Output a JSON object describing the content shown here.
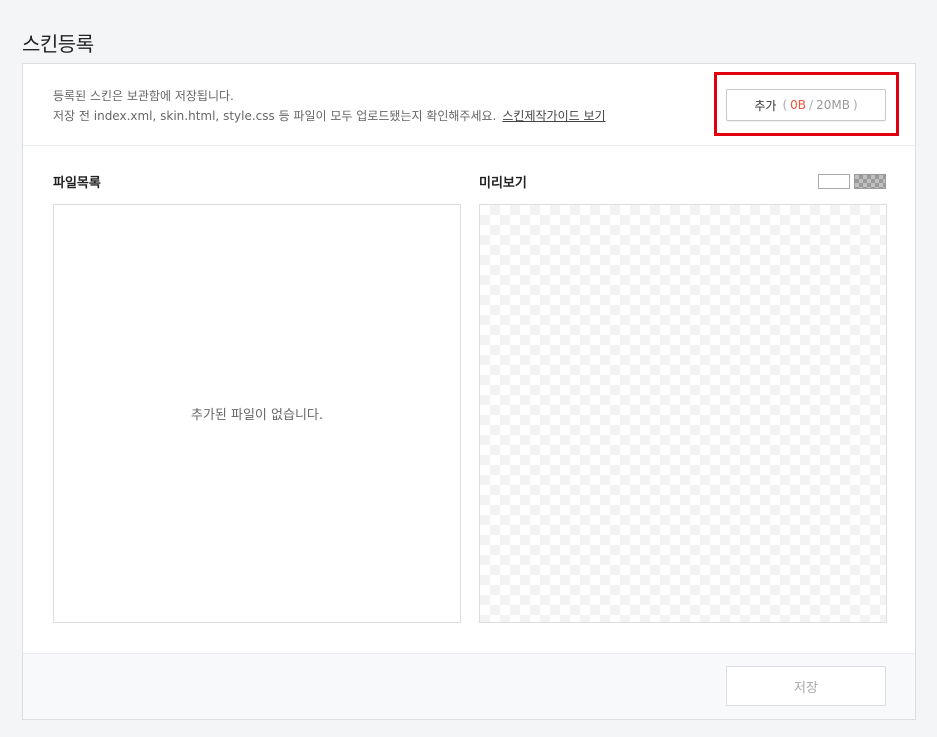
{
  "page": {
    "title": "스킨등록"
  },
  "info": {
    "line1": "등록된 스킨은 보관함에 저장됩니다.",
    "line2": "저장 전 index.xml, skin.html, style.css 등 파일이 모두 업로드됐는지 확인해주세요.",
    "guide_link": "스킨제작가이드 보기"
  },
  "add_button": {
    "label": "추가",
    "open_paren": "(",
    "used": "0B",
    "slash": "/",
    "limit": "20MB",
    "close_paren": ")"
  },
  "file_list": {
    "label": "파일목록",
    "empty_message": "추가된 파일이 없습니다."
  },
  "preview": {
    "label": "미리보기"
  },
  "footer": {
    "save_label": "저장"
  },
  "colors": {
    "highlight": "#e0000f",
    "used_size": "#f0563c"
  }
}
